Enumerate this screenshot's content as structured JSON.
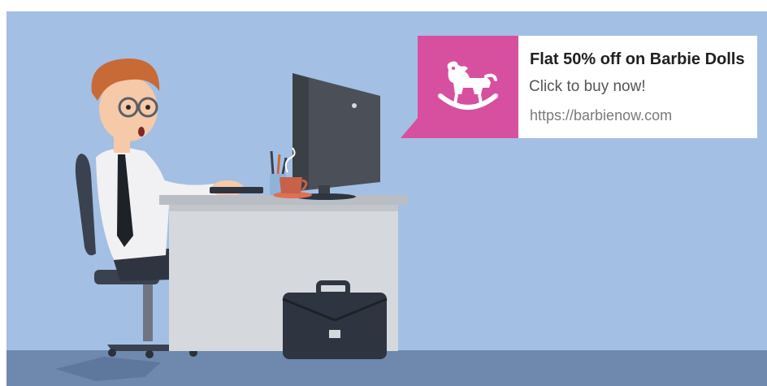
{
  "notification": {
    "title": "Flat 50% off on Barbie Dolls",
    "subtitle": "Click to buy now!",
    "url": "https://barbienow.com",
    "icon": "rocking-horse-icon",
    "accent_color": "#d6509f"
  },
  "scene": {
    "background_color": "#a4bfe4",
    "floor_color": "#6e89ad",
    "illustration": "office-worker-at-computer-illustration"
  }
}
